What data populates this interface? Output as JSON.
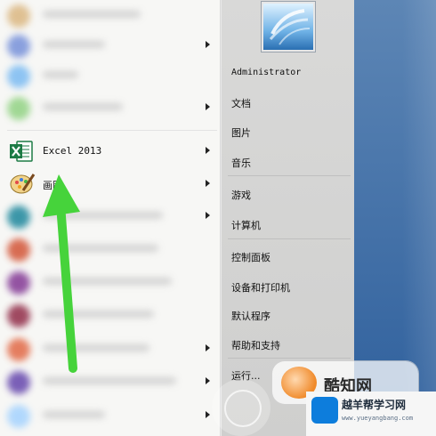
{
  "start_menu": {
    "left_items": [
      {
        "label": "",
        "has_arrow": false
      },
      {
        "label": "",
        "has_arrow": true
      },
      {
        "label": "",
        "has_arrow": false
      },
      {
        "label": "",
        "has_arrow": true
      },
      {
        "label": "Excel 2013",
        "has_arrow": true
      },
      {
        "label": "画图",
        "has_arrow": true
      },
      {
        "label": "",
        "has_arrow": true
      },
      {
        "label": "",
        "has_arrow": false
      },
      {
        "label": "",
        "has_arrow": false
      },
      {
        "label": "",
        "has_arrow": false
      },
      {
        "label": "",
        "has_arrow": false
      },
      {
        "label": "",
        "has_arrow": true
      },
      {
        "label": "",
        "has_arrow": true
      },
      {
        "label": "",
        "has_arrow": true
      }
    ],
    "right_items": [
      {
        "label": "Administrator"
      },
      {
        "label": "文档"
      },
      {
        "label": "图片"
      },
      {
        "label": "音乐"
      },
      {
        "label": "游戏"
      },
      {
        "label": "计算机"
      },
      {
        "label": "控制面板"
      },
      {
        "label": "设备和打印机"
      },
      {
        "label": "默认程序"
      },
      {
        "label": "帮助和支持"
      },
      {
        "label": "运行..."
      }
    ]
  },
  "watermarks": {
    "top_brand": "酷知网",
    "bottom_brand": "越羊帮学习网",
    "bottom_url": "www.yueyangbang.com"
  },
  "colors": {
    "excel_green": "#1d7b45",
    "arrow_green": "#46d33b",
    "desktop_blue": "#2e5f9c"
  },
  "icons": {
    "excel": "excel-icon",
    "paint": "paint-palette-icon",
    "user": "user-avatar-icon"
  }
}
